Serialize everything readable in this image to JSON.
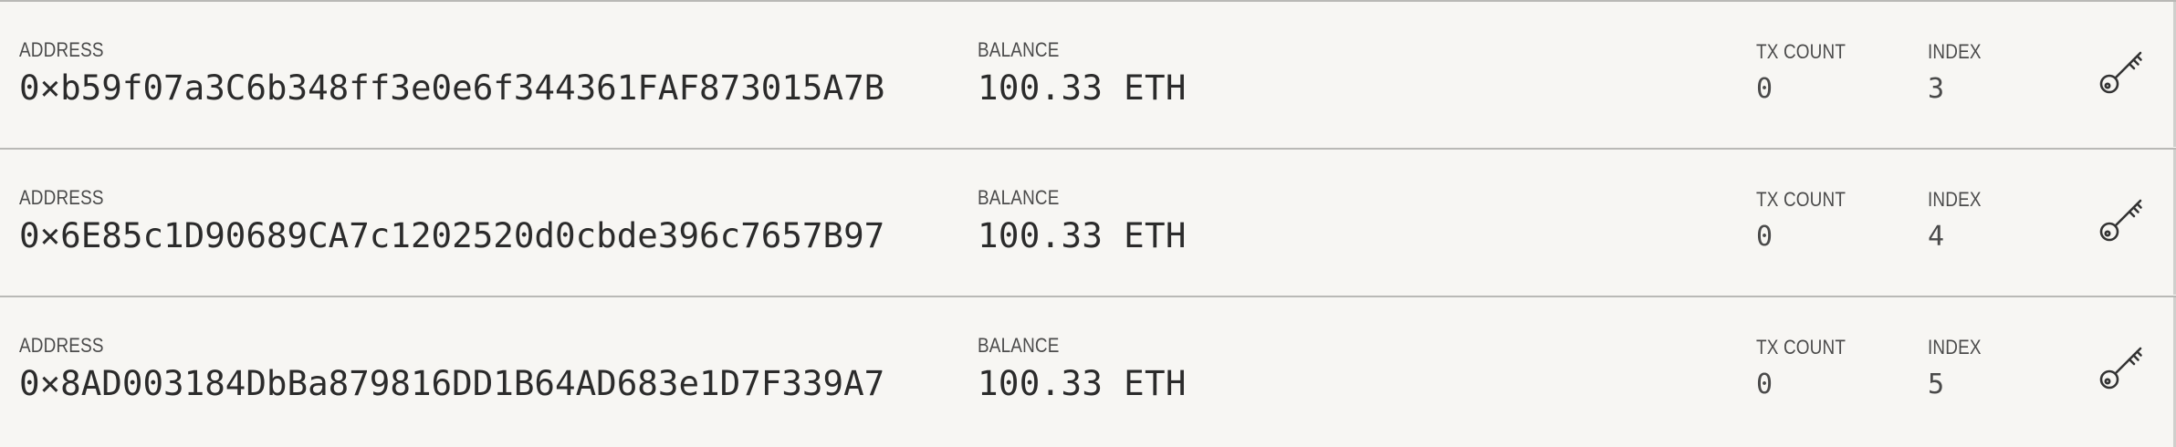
{
  "accounts": [
    {
      "address_label": "ADDRESS",
      "address": "0×b59f07a3C6b348ff3e0e6f344361FAF873015A7B",
      "balance_label": "BALANCE",
      "balance": "100.33 ETH",
      "tx_count_label": "TX COUNT",
      "tx_count": "0",
      "index_label": "INDEX",
      "index": "3",
      "action_icon": "key-icon"
    },
    {
      "address_label": "ADDRESS",
      "address": "0×6E85c1D90689CA7c1202520d0cbde396c7657B97",
      "balance_label": "BALANCE",
      "balance": "100.33 ETH",
      "tx_count_label": "TX COUNT",
      "tx_count": "0",
      "index_label": "INDEX",
      "index": "4",
      "action_icon": "key-icon"
    },
    {
      "address_label": "ADDRESS",
      "address": "0×8AD003184DbBa879816DD1B64AD683e1D7F339A7",
      "balance_label": "BALANCE",
      "balance": "100.33 ETH",
      "tx_count_label": "TX COUNT",
      "tx_count": "0",
      "index_label": "INDEX",
      "index": "5",
      "action_icon": "key-icon"
    }
  ],
  "colors": {
    "background": "#f7f6f3",
    "divider": "#b9b9b6",
    "text": "#2b2b2b",
    "label": "#4b4b4b"
  }
}
